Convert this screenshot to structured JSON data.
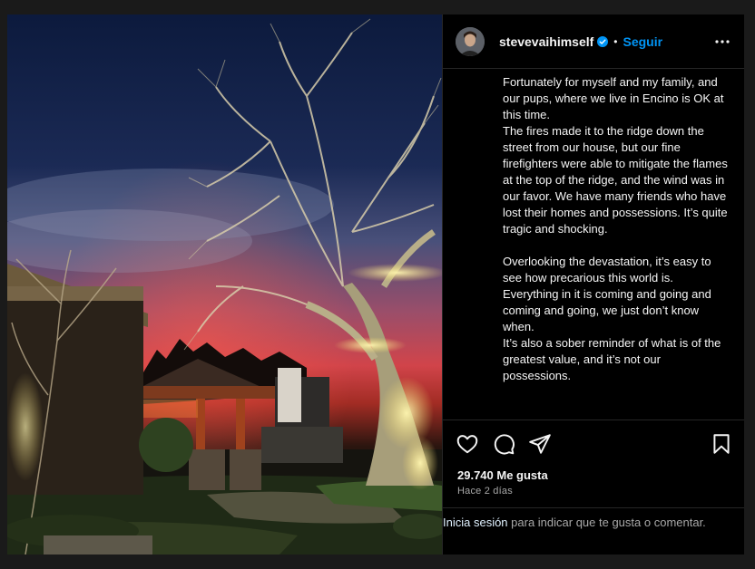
{
  "post": {
    "username": "stevevaihimself",
    "follow_label": "Seguir",
    "separator": "•",
    "caption": "Fortunately for myself and my family, and our pups, where we live in Encino is OK at this time.\nThe fires made it to the ridge down the street from our house, but our fine firefighters were able to mitigate the flames at the top of the ridge, and the wind was in our favor. We have many friends who have lost their homes and possessions. It’s quite tragic and shocking.\n\nOverlooking the devastation, it’s easy to see how precarious this world is. Everything in it is coming and going and coming and going, we just don’t know when.\nIt’s also a sober reminder of what is of the greatest value, and it’s not our possessions.",
    "likes": "29.740 Me gusta",
    "time_ago": "Hace 2 días"
  },
  "login_prompt": {
    "link": "Inicia sesión",
    "text": " para indicar que te gusta o comentar."
  },
  "icons": {
    "verified": "verified-badge-icon",
    "more": "more-options-icon",
    "like": "heart-icon",
    "comment": "comment-icon",
    "share": "send-icon",
    "save": "bookmark-icon"
  },
  "colors": {
    "accent": "#0095f6",
    "background": "#000000",
    "muted_text": "#a8a8a8",
    "divider": "#262626"
  }
}
